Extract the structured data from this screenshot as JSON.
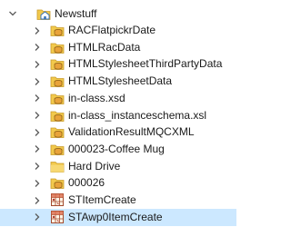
{
  "tree": {
    "parent": {
      "label": "Newstuff",
      "expanded": true
    },
    "children": [
      {
        "label": "RACFlatpickrDate",
        "icon": "data-folder-icon"
      },
      {
        "label": "HTMLRacData",
        "icon": "data-folder-icon"
      },
      {
        "label": "HTMLStylesheetThirdPartyData",
        "icon": "data-folder-icon"
      },
      {
        "label": "HTMLStylesheetData",
        "icon": "data-folder-icon"
      },
      {
        "label": "in-class.xsd",
        "icon": "data-folder-icon"
      },
      {
        "label": "in-class_instanceschema.xsl",
        "icon": "data-folder-icon"
      },
      {
        "label": "ValidationResultMQCXML",
        "icon": "data-folder-icon"
      },
      {
        "label": "000023-Coffee Mug",
        "icon": "data-folder-icon"
      },
      {
        "label": "Hard Drive",
        "icon": "plain-folder-icon"
      },
      {
        "label": "000026",
        "icon": "data-folder-icon"
      },
      {
        "label": "STItemCreate",
        "icon": "table-icon"
      },
      {
        "label": "STAwp0ItemCreate",
        "icon": "table-icon",
        "selected": true
      }
    ]
  },
  "colors": {
    "selection": "#cce8ff",
    "folder": "#f2c94c",
    "chevron": "#5a5a5a"
  }
}
